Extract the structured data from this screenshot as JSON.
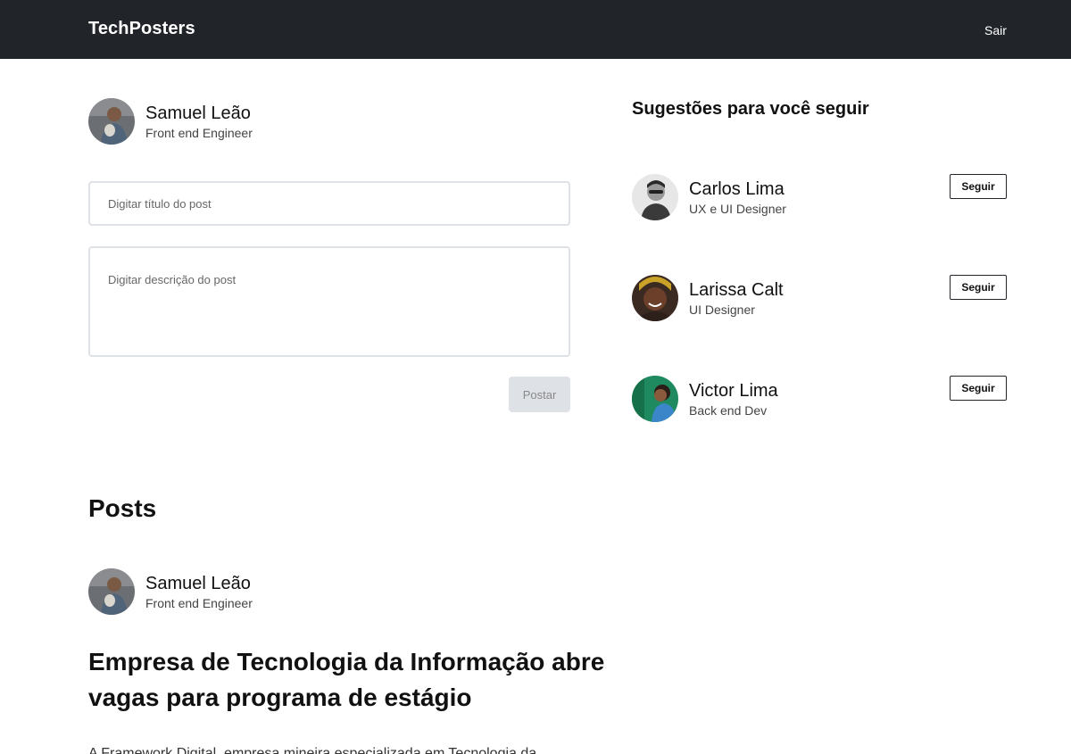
{
  "header": {
    "brand": "TechPosters",
    "logout_label": "Sair"
  },
  "current_user": {
    "name": "Samuel Leão",
    "role": "Front end Engineer"
  },
  "composer": {
    "title_placeholder": "Digitar título do post",
    "description_placeholder": "Digitar descrição do post",
    "submit_label": "Postar"
  },
  "suggestions": {
    "heading": "Sugestões para você seguir",
    "follow_label": "Seguir",
    "users": [
      {
        "name": "Carlos Lima",
        "role": "UX e UI Designer"
      },
      {
        "name": "Larissa Calt",
        "role": "UI Designer"
      },
      {
        "name": "Victor Lima",
        "role": "Back end Dev"
      }
    ]
  },
  "posts": {
    "heading": "Posts",
    "items": [
      {
        "author": "Samuel Leão",
        "role": "Front end Engineer",
        "title": "Empresa de Tecnologia da Informação abre vagas para programa de estágio",
        "excerpt": "A Framework Digital, empresa mineira especializada em Tecnologia da"
      }
    ]
  }
}
